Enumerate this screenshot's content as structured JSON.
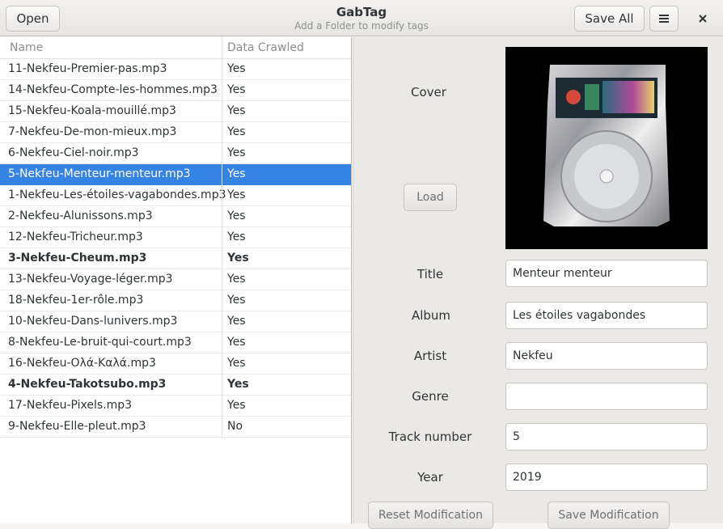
{
  "header": {
    "open_label": "Open",
    "title": "GabTag",
    "subtitle": "Add a Folder to modify tags",
    "save_all_label": "Save All",
    "menu_icon": "hamburger-menu-icon",
    "close_icon": "close-icon"
  },
  "list": {
    "columns": [
      "Name",
      "Data Crawled"
    ],
    "rows": [
      {
        "name": "11-Nekfeu-Premier-pas.mp3",
        "crawled": "Yes"
      },
      {
        "name": "14-Nekfeu-Compte-les-hommes.mp3",
        "crawled": "Yes"
      },
      {
        "name": "15-Nekfeu-Koala-mouillé.mp3",
        "crawled": "Yes"
      },
      {
        "name": "7-Nekfeu-De-mon-mieux.mp3",
        "crawled": "Yes"
      },
      {
        "name": "6-Nekfeu-Ciel-noir.mp3",
        "crawled": "Yes"
      },
      {
        "name": "5-Nekfeu-Menteur-menteur.mp3",
        "crawled": "Yes"
      },
      {
        "name": "1-Nekfeu-Les-étoiles-vagabondes.mp3",
        "crawled": "Yes"
      },
      {
        "name": "2-Nekfeu-Alunissons.mp3",
        "crawled": "Yes"
      },
      {
        "name": "12-Nekfeu-Tricheur.mp3",
        "crawled": "Yes"
      },
      {
        "name": "3-Nekfeu-Cheum.mp3",
        "crawled": "Yes"
      },
      {
        "name": "13-Nekfeu-Voyage-léger.mp3",
        "crawled": "Yes"
      },
      {
        "name": "18-Nekfeu-1er-rôle.mp3",
        "crawled": "Yes"
      },
      {
        "name": "10-Nekfeu-Dans-lunivers.mp3",
        "crawled": "Yes"
      },
      {
        "name": "8-Nekfeu-Le-bruit-qui-court.mp3",
        "crawled": "Yes"
      },
      {
        "name": "16-Nekfeu-Ολά-Καλά.mp3",
        "crawled": "Yes"
      },
      {
        "name": "4-Nekfeu-Takotsubo.mp3",
        "crawled": "Yes"
      },
      {
        "name": "17-Nekfeu-Pixels.mp3",
        "crawled": "Yes"
      },
      {
        "name": "9-Nekfeu-Elle-pleut.mp3",
        "crawled": "No"
      }
    ],
    "selected_index": 5,
    "bold_indices": [
      9,
      15
    ]
  },
  "editor": {
    "cover_label": "Cover",
    "load_label": "Load",
    "title_label": "Title",
    "title_value": "Menteur menteur",
    "album_label": "Album",
    "album_value": "Les étoiles vagabondes",
    "artist_label": "Artist",
    "artist_value": "Nekfeu",
    "genre_label": "Genre",
    "genre_value": "",
    "track_label": "Track number",
    "track_value": "5",
    "year_label": "Year",
    "year_value": "2019",
    "reset_label": "Reset Modification",
    "save_label": "Save Modification"
  },
  "colors": {
    "selection": "#3584e4"
  }
}
